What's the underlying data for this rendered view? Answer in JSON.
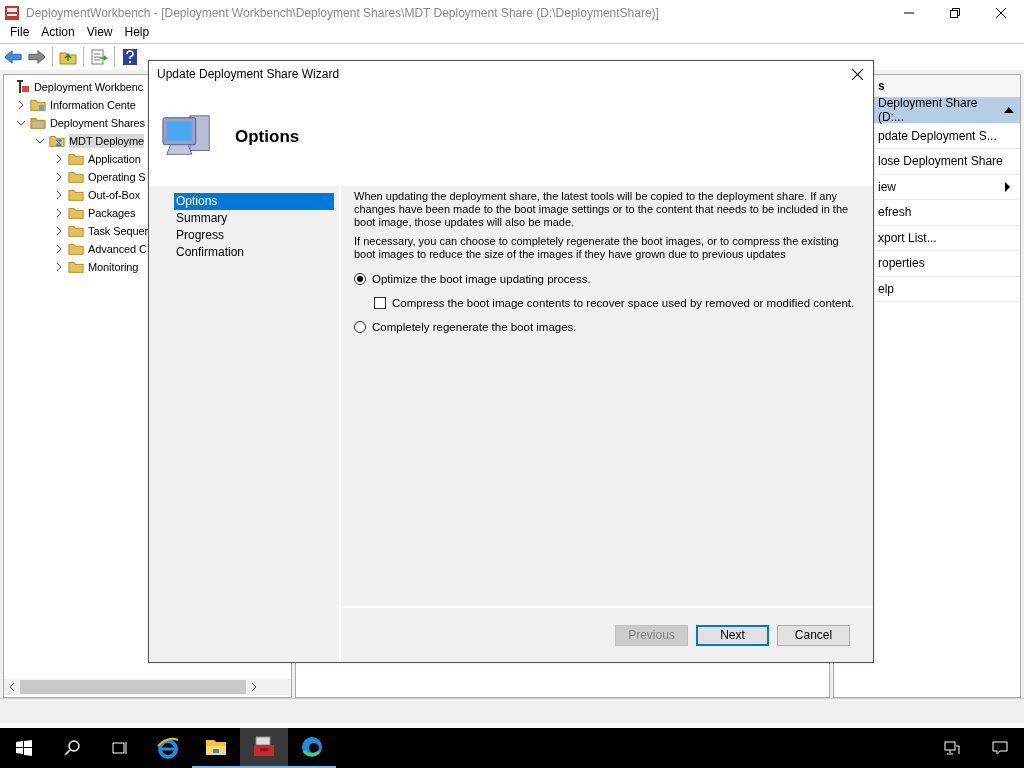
{
  "window": {
    "title": "DeploymentWorkbench - [Deployment Workbench\\Deployment Shares\\MDT Deployment Share (D:\\DeploymentShare)]"
  },
  "menu": [
    "File",
    "Action",
    "View",
    "Help"
  ],
  "tree": [
    {
      "label": "Deployment Workbenc",
      "kind": "root",
      "selected": false,
      "children": [
        {
          "label": "Information Cente",
          "kind": "info",
          "expanded": false,
          "selected": false
        },
        {
          "label": "Deployment Shares",
          "kind": "shares",
          "expanded": true,
          "selected": false,
          "children": [
            {
              "label": "MDT Deployme",
              "kind": "share",
              "expanded": true,
              "selected": true,
              "children": [
                {
                  "label": "Application",
                  "kind": "folder",
                  "expanded": false,
                  "selected": false
                },
                {
                  "label": "Operating S",
                  "kind": "folder",
                  "expanded": false,
                  "selected": false
                },
                {
                  "label": "Out-of-Box",
                  "kind": "folder",
                  "expanded": false,
                  "selected": false
                },
                {
                  "label": "Packages",
                  "kind": "folder",
                  "expanded": false,
                  "selected": false
                },
                {
                  "label": "Task Sequer",
                  "kind": "folder",
                  "expanded": false,
                  "selected": false
                },
                {
                  "label": "Advanced C",
                  "kind": "folder",
                  "expanded": false,
                  "selected": false
                },
                {
                  "label": "Monitoring",
                  "kind": "folder",
                  "expanded": false,
                  "selected": false
                }
              ]
            }
          ]
        }
      ]
    }
  ],
  "actions": {
    "header": "s",
    "items": [
      {
        "label": "Deployment Share (D:...",
        "kind": "section"
      },
      {
        "label": "pdate Deployment S...",
        "kind": "item"
      },
      {
        "label": "lose Deployment Share",
        "kind": "item"
      },
      {
        "label": "iew",
        "kind": "submenu"
      },
      {
        "label": "efresh",
        "kind": "item"
      },
      {
        "label": "xport List...",
        "kind": "item"
      },
      {
        "label": "roperties",
        "kind": "item"
      },
      {
        "label": "elp",
        "kind": "item"
      }
    ]
  },
  "dialog": {
    "title": "Update Deployment Share Wizard",
    "heading": "Options",
    "steps": [
      {
        "label": "Options",
        "selected": true
      },
      {
        "label": "Summary",
        "selected": false
      },
      {
        "label": "Progress",
        "selected": false
      },
      {
        "label": "Confirmation",
        "selected": false
      }
    ],
    "paragraphs": [
      "When updating the deployment share, the latest tools will be copied to the deployment share.  If any changes have been made to the boot image settings or to the content that needs to be included in the boot image, those updates will also be made.",
      "If necessary, you can choose to completely regenerate the boot images, or to compress the existing boot images to reduce the size of the images if they have grown due to previous updates"
    ],
    "options": [
      {
        "kind": "radio",
        "label": "Optimize the boot image updating process.",
        "checked": true
      },
      {
        "kind": "checkbox",
        "label": "Compress the boot image contents to recover space used by removed or modified content.",
        "checked": false
      },
      {
        "kind": "radio",
        "label": "Completely regenerate the boot images.",
        "checked": false
      }
    ],
    "buttons": [
      {
        "label": "Previous",
        "disabled": true,
        "default": false
      },
      {
        "label": "Next",
        "disabled": false,
        "default": true
      },
      {
        "label": "Cancel",
        "disabled": false,
        "default": false
      }
    ]
  },
  "taskbar": {
    "apps": [
      {
        "kind": "ie",
        "running": false,
        "selected": false
      },
      {
        "kind": "explorer",
        "running": true,
        "selected": false
      },
      {
        "kind": "toolbox",
        "running": true,
        "selected": true
      },
      {
        "kind": "edge",
        "running": true,
        "selected": false
      }
    ]
  }
}
